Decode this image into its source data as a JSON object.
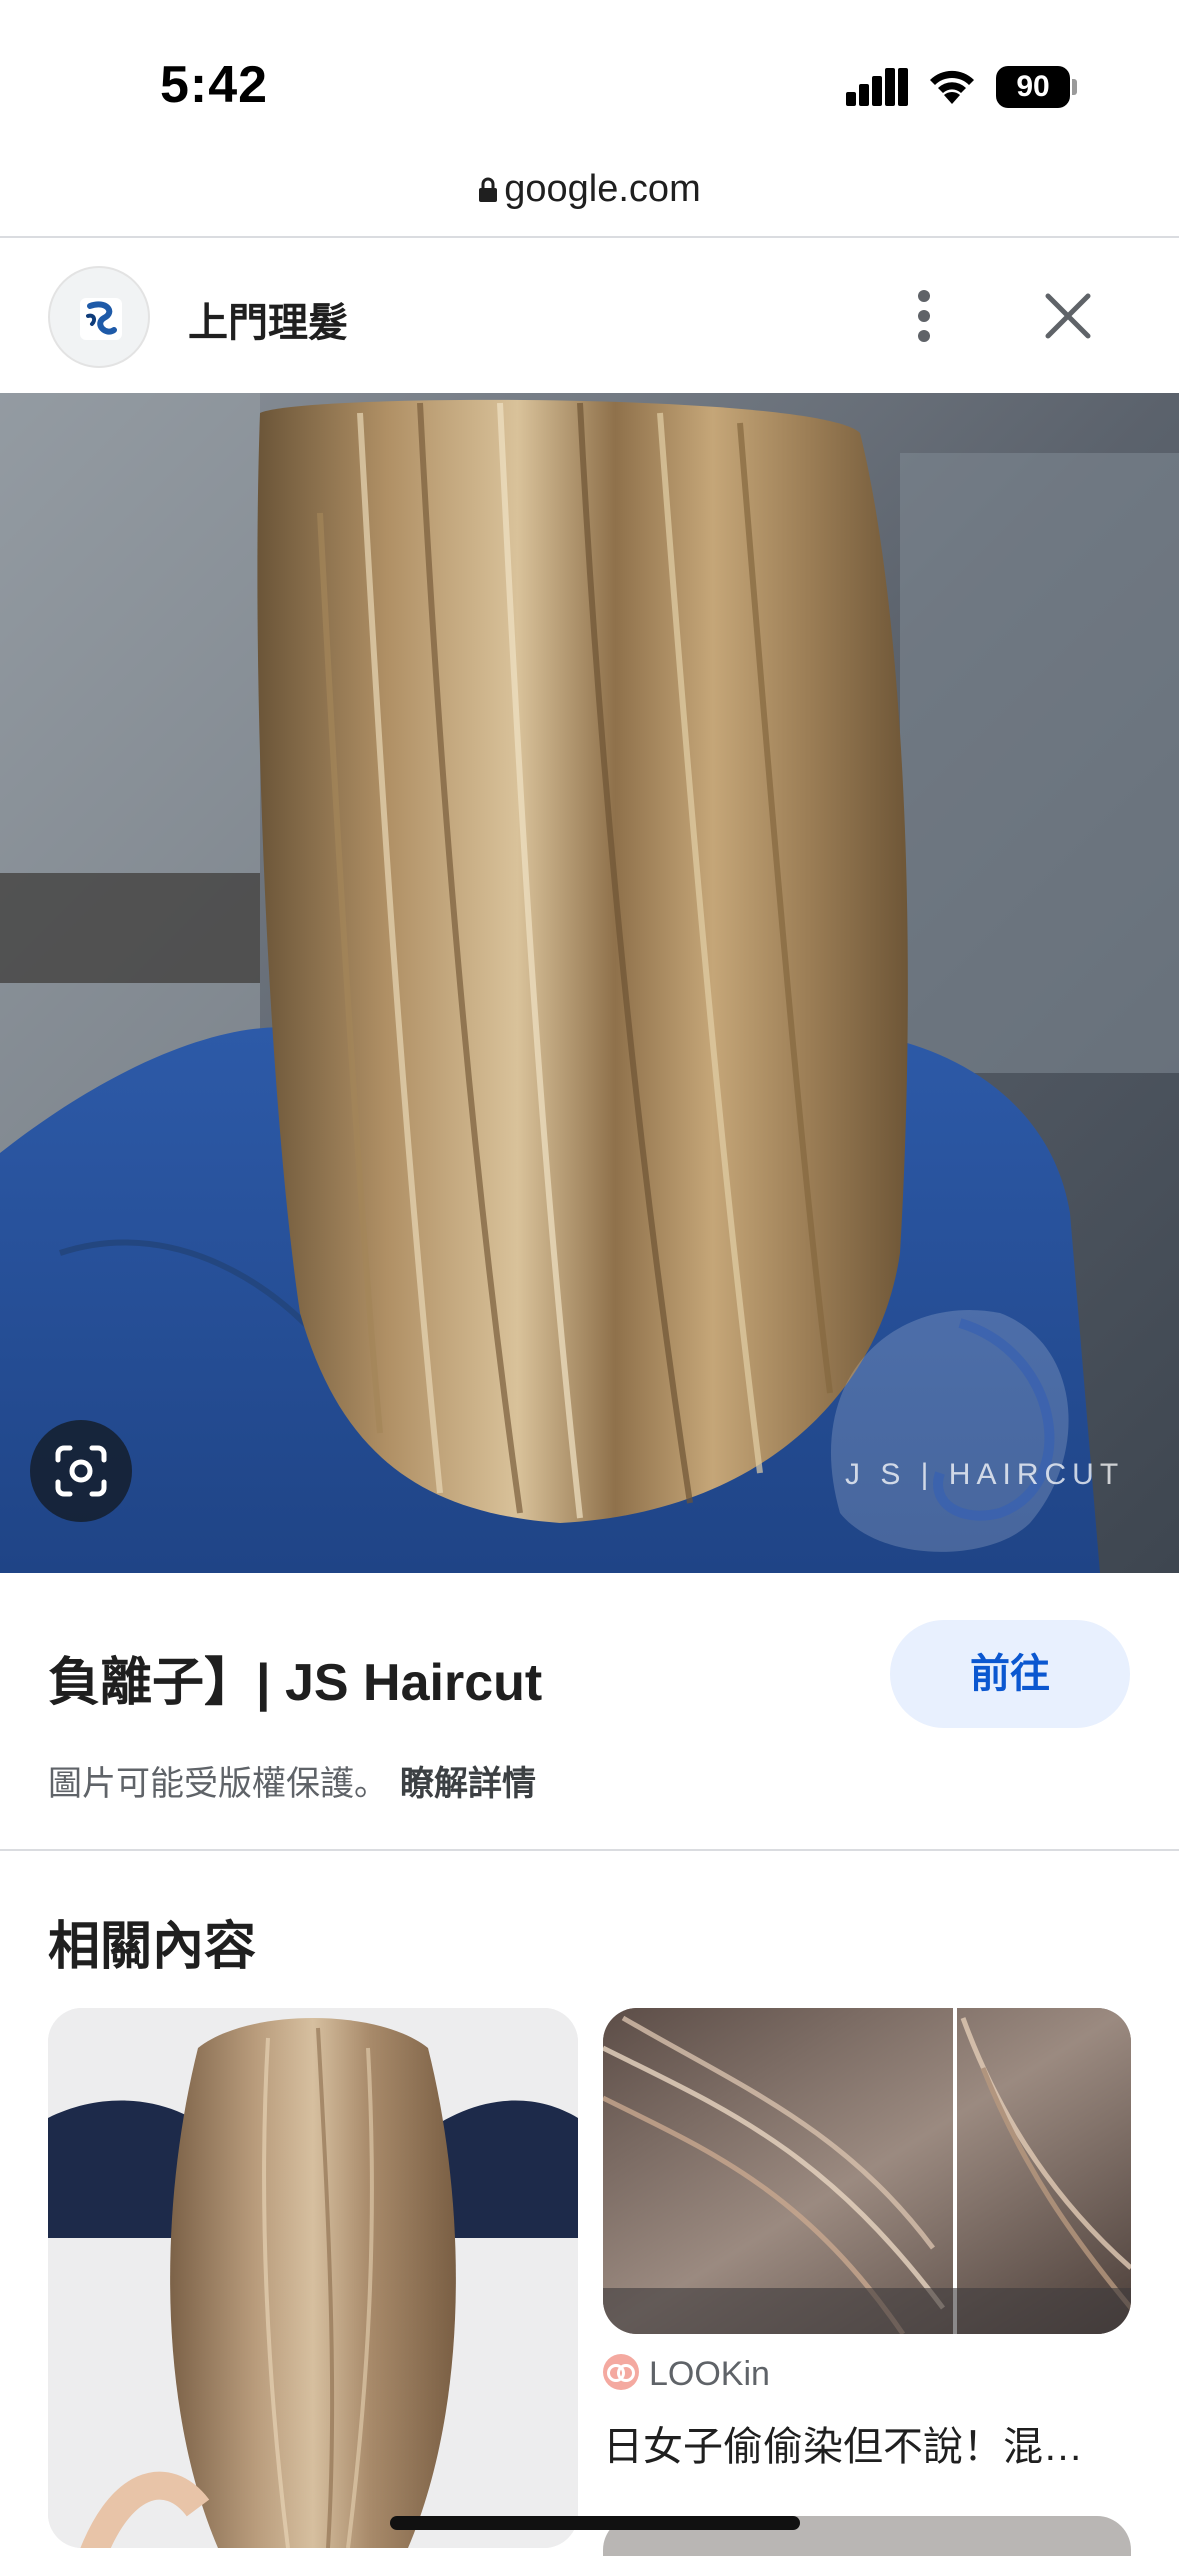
{
  "status_bar": {
    "time": "5:42",
    "battery": "90"
  },
  "url_bar": {
    "domain": "google.com"
  },
  "source_header": {
    "title": "上門理髮"
  },
  "main_image": {
    "watermark": "J S | HAIRCUT"
  },
  "result": {
    "title": "負離子】| JS Haircut",
    "go_button": "前往",
    "copyright": "圖片可能受版權保護。",
    "learn_more": "瞭解詳情"
  },
  "related": {
    "heading": "相關內容",
    "items": [
      {
        "source": "LOOKin",
        "caption": "日女子偷偷染但不說！混…"
      }
    ]
  },
  "colors": {
    "accent": "#0b57d0",
    "button_bg": "#e8f0fe"
  }
}
